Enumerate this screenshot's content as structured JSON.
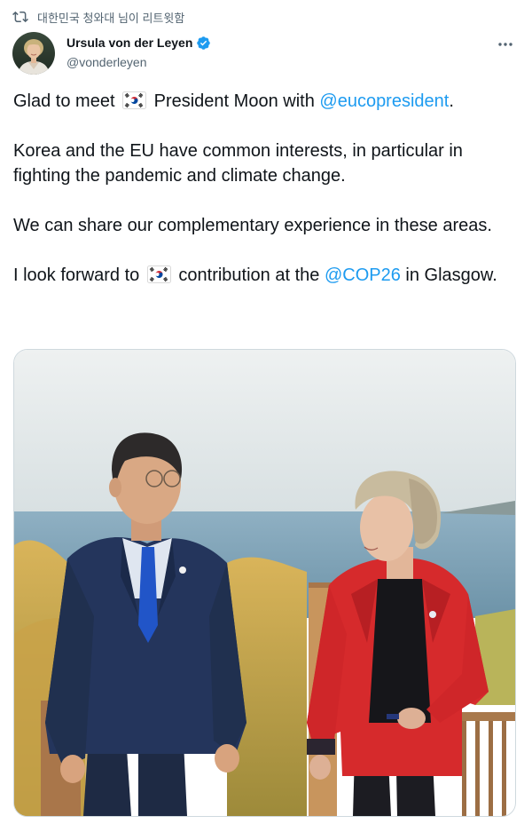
{
  "retweet_context": {
    "icon": "retweet-icon",
    "label": "대한민국 청와대 님이 리트윗함"
  },
  "author": {
    "name": "Ursula von der Leyen",
    "handle": "@vonderleyen",
    "verified": true,
    "verified_color": "#1d9bf0"
  },
  "more_icon": "ellipsis-icon",
  "tweet": {
    "p1_before": "Glad to meet ",
    "p1_flag": "south-korea-flag-icon",
    "p1_middle": " President Moon with ",
    "p1_mention": "@eucopresident",
    "p1_after": ".",
    "p2": "Korea and the EU have common interests, in particular in fighting the pandemic and climate change.",
    "p3": "We can share our complementary experience in these areas.",
    "p4_before": "I look forward to ",
    "p4_flag": "south-korea-flag-icon",
    "p4_middle": " contribution at the ",
    "p4_mention": "@COP26",
    "p4_after": " in Glasgow."
  },
  "colors": {
    "text": "#0f1419",
    "secondary": "#536471",
    "link": "#1d9bf0",
    "border": "#cfd9de"
  }
}
